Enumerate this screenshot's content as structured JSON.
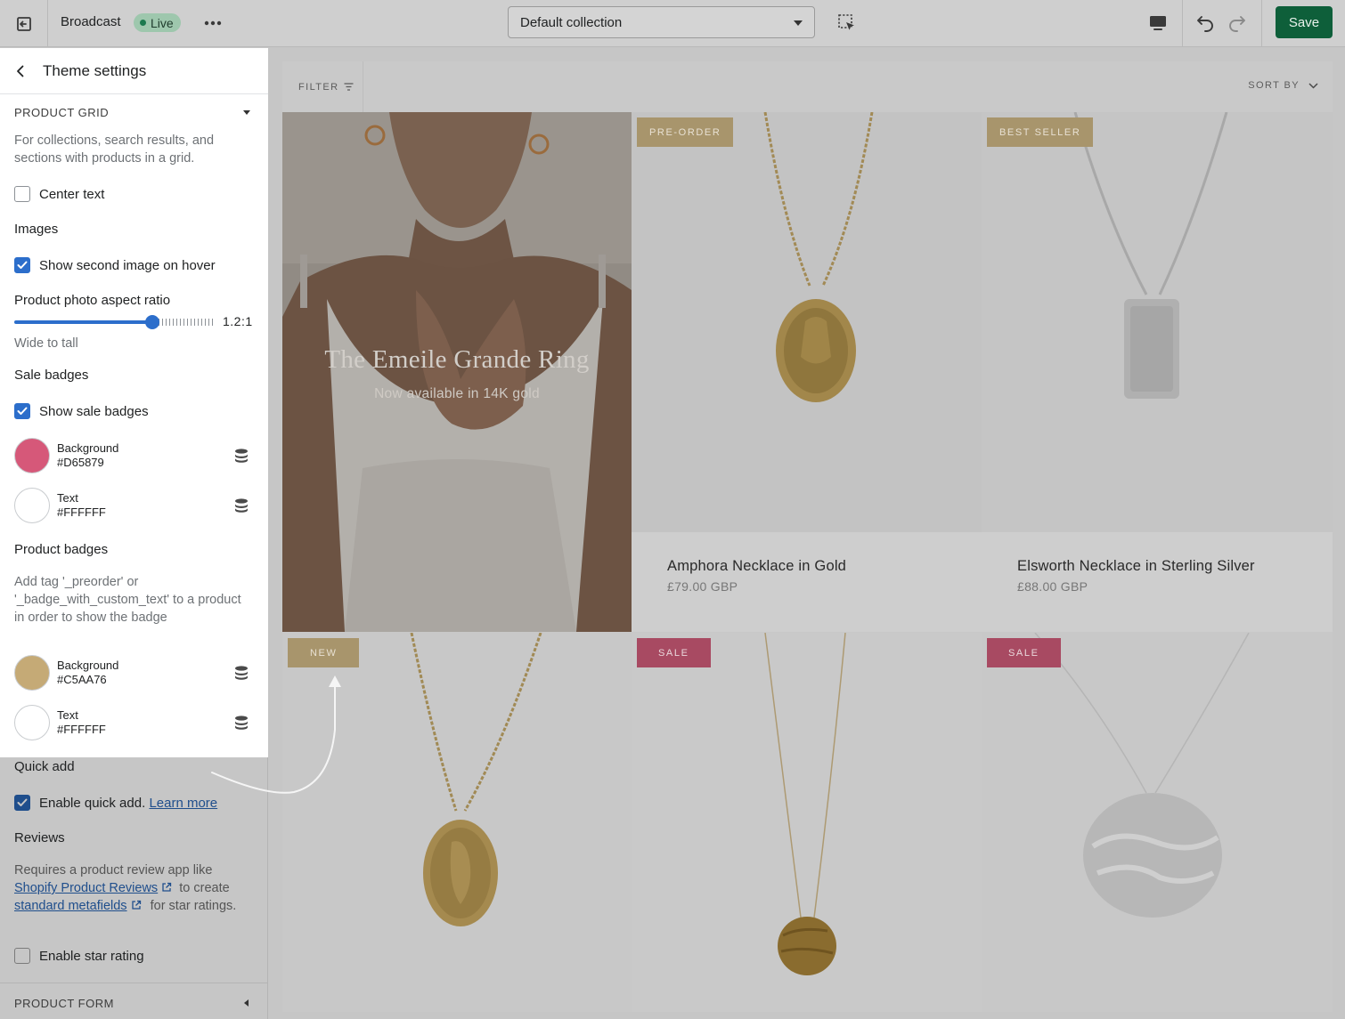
{
  "topbar": {
    "theme_name": "Broadcast",
    "status_badge": "Live",
    "template_select": "Default collection",
    "save_label": "Save"
  },
  "sidebar": {
    "panel_title": "Theme settings",
    "product_grid": {
      "section_title": "PRODUCT GRID",
      "description": "For collections, search results, and sections with products in a grid.",
      "center_text_label": "Center text",
      "center_text_checked": false,
      "images_heading": "Images",
      "second_image_label": "Show second image on hover",
      "second_image_checked": true,
      "aspect_ratio_label": "Product photo aspect ratio",
      "aspect_ratio_value": "1.2:1",
      "aspect_ratio_fraction": 0.68,
      "aspect_ratio_help": "Wide to tall",
      "sale_badges_heading": "Sale badges",
      "show_sale_badges_label": "Show sale badges",
      "show_sale_badges_checked": true,
      "sale_bg_label": "Background",
      "sale_bg_hex": "#D65879",
      "sale_text_label": "Text",
      "sale_text_hex": "#FFFFFF",
      "product_badges_heading": "Product badges",
      "product_badges_help": "Add tag '_preorder' or '_badge_with_custom_text' to a product in order to show the badge",
      "product_bg_label": "Background",
      "product_bg_hex": "#C5AA76",
      "product_text_label": "Text",
      "product_text_hex": "#FFFFFF",
      "quick_add_heading": "Quick add",
      "quick_add_label": "Enable quick add.",
      "quick_add_link": "Learn more",
      "quick_add_checked": true,
      "reviews_heading": "Reviews",
      "reviews_help_1": "Requires a product review app like",
      "reviews_link_1": "Shopify Product Reviews",
      "reviews_help_2": "to create",
      "reviews_link_2": "standard metafields",
      "reviews_help_3": "for star ratings.",
      "star_rating_label": "Enable star rating",
      "star_rating_checked": false
    },
    "next_section_title": "PRODUCT FORM"
  },
  "preview": {
    "filter_label": "FILTER",
    "sort_label": "SORT BY",
    "hero": {
      "title": "The Emeile Grande Ring",
      "subtitle": "Now available in 14K gold"
    },
    "products": [
      {
        "badge": "PRE-ORDER",
        "name": "Amphora Necklace in Gold",
        "price": "£79.00 GBP"
      },
      {
        "badge": "BEST SELLER",
        "name": "Elsworth Necklace in Sterling Silver",
        "price": "£88.00 GBP"
      },
      {
        "badge": "NEW"
      },
      {
        "badge": "SALE"
      },
      {
        "badge": "SALE"
      }
    ]
  },
  "colors": {
    "accent": "#2c6ecb",
    "save_button": "#0e5f3a",
    "sale_badge_swatch": "#D65879",
    "product_badge_swatch": "#C5AA76"
  }
}
